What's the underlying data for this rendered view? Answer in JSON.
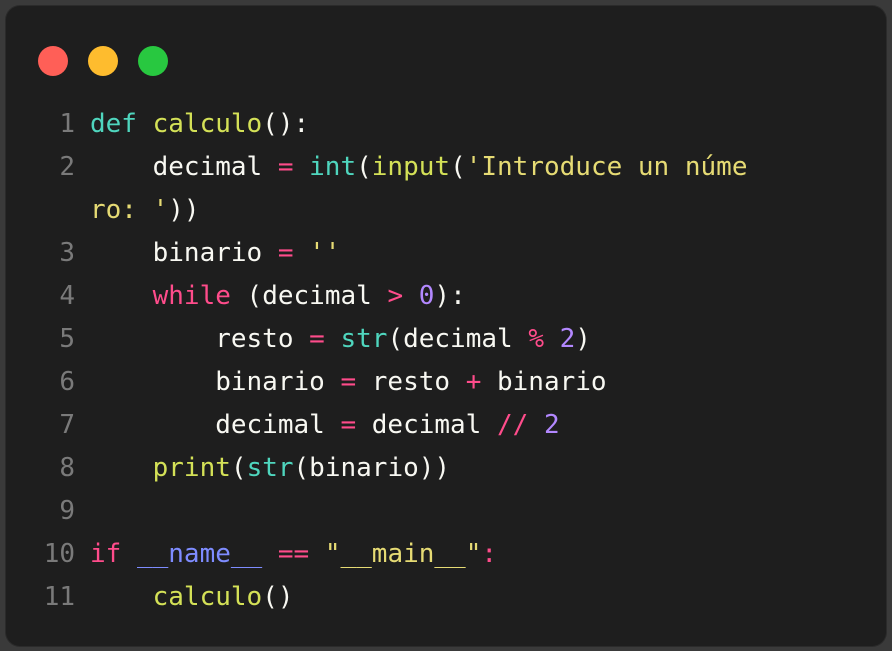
{
  "window": {
    "controls": [
      "close",
      "minimize",
      "zoom"
    ]
  },
  "code": {
    "lines": [
      {
        "n": "1",
        "tokens": [
          {
            "t": "def",
            "c": "def"
          },
          {
            "t": " ",
            "c": ""
          },
          {
            "t": "calculo",
            "c": "fn"
          },
          {
            "t": "():",
            "c": ""
          }
        ]
      },
      {
        "n": "2",
        "tokens": [
          {
            "t": "    decimal ",
            "c": ""
          },
          {
            "t": "=",
            "c": "op"
          },
          {
            "t": " ",
            "c": ""
          },
          {
            "t": "int",
            "c": "bi"
          },
          {
            "t": "(",
            "c": ""
          },
          {
            "t": "input",
            "c": "fn"
          },
          {
            "t": "(",
            "c": ""
          },
          {
            "t": "'Introduce un núme",
            "c": "str"
          }
        ],
        "wrap": [
          {
            "t": "ro: '",
            "c": "str"
          },
          {
            "t": "))",
            "c": ""
          }
        ]
      },
      {
        "n": "3",
        "tokens": [
          {
            "t": "    binario ",
            "c": ""
          },
          {
            "t": "=",
            "c": "op"
          },
          {
            "t": " ",
            "c": ""
          },
          {
            "t": "''",
            "c": "str"
          }
        ]
      },
      {
        "n": "4",
        "tokens": [
          {
            "t": "    ",
            "c": ""
          },
          {
            "t": "while",
            "c": "kw"
          },
          {
            "t": " (decimal ",
            "c": ""
          },
          {
            "t": ">",
            "c": "op"
          },
          {
            "t": " ",
            "c": ""
          },
          {
            "t": "0",
            "c": "num"
          },
          {
            "t": "):",
            "c": ""
          }
        ]
      },
      {
        "n": "5",
        "tokens": [
          {
            "t": "        resto ",
            "c": ""
          },
          {
            "t": "=",
            "c": "op"
          },
          {
            "t": " ",
            "c": ""
          },
          {
            "t": "str",
            "c": "bi"
          },
          {
            "t": "(decimal ",
            "c": ""
          },
          {
            "t": "%",
            "c": "op"
          },
          {
            "t": " ",
            "c": ""
          },
          {
            "t": "2",
            "c": "num"
          },
          {
            "t": ")",
            "c": ""
          }
        ]
      },
      {
        "n": "6",
        "tokens": [
          {
            "t": "        binario ",
            "c": ""
          },
          {
            "t": "=",
            "c": "op"
          },
          {
            "t": " resto ",
            "c": ""
          },
          {
            "t": "+",
            "c": "op"
          },
          {
            "t": " binario",
            "c": ""
          }
        ]
      },
      {
        "n": "7",
        "tokens": [
          {
            "t": "        decimal ",
            "c": ""
          },
          {
            "t": "=",
            "c": "op"
          },
          {
            "t": " decimal ",
            "c": ""
          },
          {
            "t": "//",
            "c": "op"
          },
          {
            "t": " ",
            "c": ""
          },
          {
            "t": "2",
            "c": "num"
          }
        ]
      },
      {
        "n": "8",
        "tokens": [
          {
            "t": "    ",
            "c": ""
          },
          {
            "t": "print",
            "c": "fn"
          },
          {
            "t": "(",
            "c": ""
          },
          {
            "t": "str",
            "c": "bi"
          },
          {
            "t": "(binario))",
            "c": ""
          }
        ]
      },
      {
        "n": "9",
        "tokens": []
      },
      {
        "n": "10",
        "tokens": [
          {
            "t": "if",
            "c": "kw"
          },
          {
            "t": " ",
            "c": ""
          },
          {
            "t": "__name__",
            "c": "dunder"
          },
          {
            "t": " ",
            "c": ""
          },
          {
            "t": "==",
            "c": "op"
          },
          {
            "t": " ",
            "c": ""
          },
          {
            "t": "\"__main__\"",
            "c": "str"
          },
          {
            "t": ":",
            "c": "op"
          }
        ]
      },
      {
        "n": "11",
        "tokens": [
          {
            "t": "    ",
            "c": ""
          },
          {
            "t": "calculo",
            "c": "fn"
          },
          {
            "t": "()",
            "c": ""
          }
        ]
      }
    ]
  }
}
